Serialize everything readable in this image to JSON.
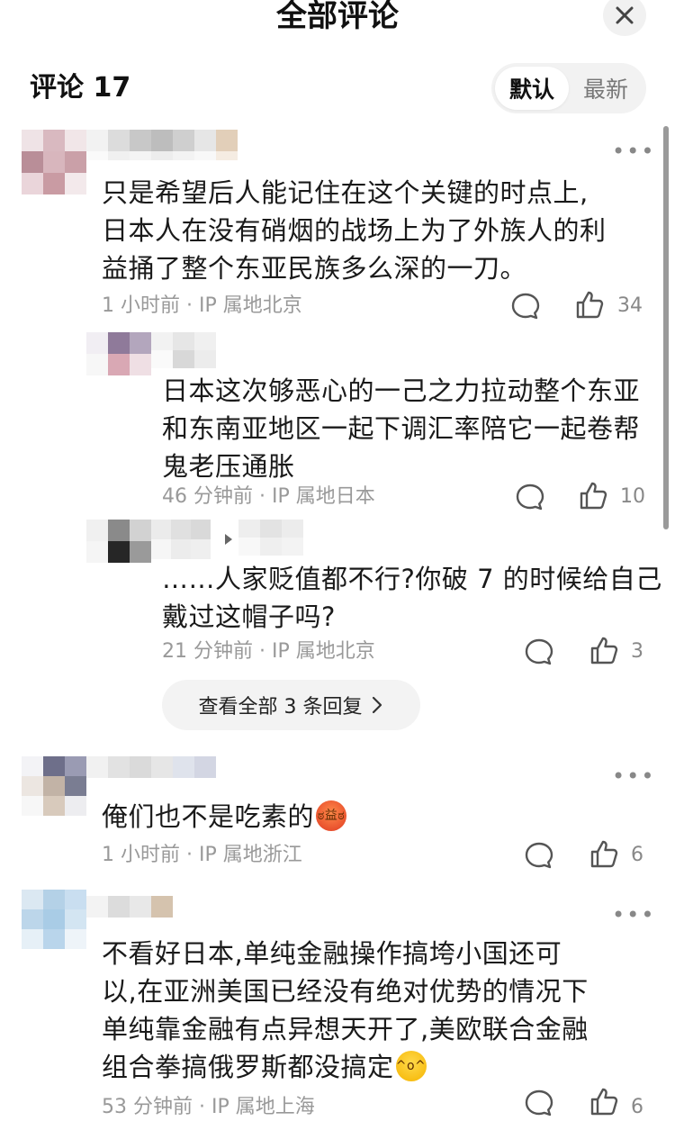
{
  "header": {
    "title": "全部评论",
    "close_icon": "close-icon"
  },
  "comments_summary": {
    "count_label": "评论 17",
    "sort_options": [
      "默认",
      "最新"
    ],
    "sort_selected": "默认"
  },
  "comments": [
    {
      "text_lines": [
        "只是希望后人能记住在这个关键的时点上,",
        "日本人在没有硝烟的战场上为了外族人的利",
        "益捅了整个东亚民族多么深的一刀。"
      ],
      "time": "1 小时前",
      "location": "IP 属地北京",
      "likes": "34"
    },
    {
      "text_lines": [
        "俺们也不是吃素的"
      ],
      "emoji": "angry-face-emoji",
      "time": "1 小时前",
      "location": "IP 属地浙江",
      "likes": "6"
    },
    {
      "text_lines": [
        "不看好日本,单纯金融操作搞垮小国还可",
        "以,在亚洲美国已经没有绝对优势的情况下",
        "单纯靠金融有点异想天开了,美欧联合金融",
        "组合拳搞俄罗斯都没搞定"
      ],
      "emoji": "tears-of-joy-emoji",
      "time": "53 分钟前",
      "location": "IP 属地上海",
      "likes": "6"
    }
  ],
  "replies": [
    {
      "text_lines": [
        "日本这次够恶心的一己之力拉动整个东亚",
        "和东南亚地区一起下调汇率陪它一起卷帮",
        "鬼老压通胀"
      ],
      "time": "46 分钟前",
      "location": "IP 属地日本",
      "likes": "10"
    },
    {
      "text_lines": [
        "……人家贬值都不行?你破 7 的时候给自己",
        "戴过这帽子吗?"
      ],
      "time": "21 分钟前",
      "location": "IP 属地北京",
      "likes": "3"
    }
  ],
  "view_replies": {
    "label": "查看全部 3 条回复",
    "icon": "chevron-right-icon"
  },
  "meta_separator": "·",
  "more_label": "•••"
}
